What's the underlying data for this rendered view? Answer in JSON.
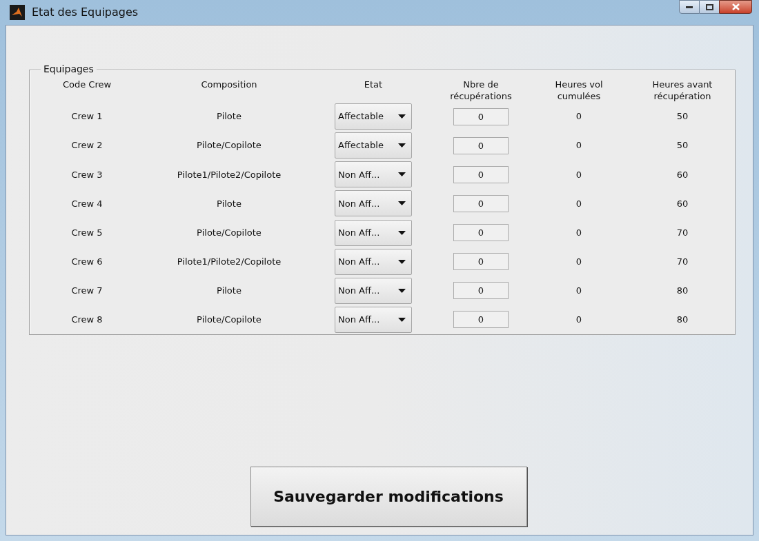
{
  "window": {
    "title": "Etat des Equipages"
  },
  "panel": {
    "title": "Equipages"
  },
  "columns": [
    "Code Crew",
    "Composition",
    "Etat",
    "Nbre de récupérations",
    "Heures vol cumulées",
    "Heures avant récupération"
  ],
  "rows": [
    {
      "code": "Crew 1",
      "composition": "Pilote",
      "etat": "Affectable",
      "recuperations": "0",
      "heures_vol": "0",
      "heures_avant": "50"
    },
    {
      "code": "Crew 2",
      "composition": "Pilote/Copilote",
      "etat": "Affectable",
      "recuperations": "0",
      "heures_vol": "0",
      "heures_avant": "50"
    },
    {
      "code": "Crew 3",
      "composition": "Pilote1/Pilote2/Copilote",
      "etat": "Non Aff...",
      "recuperations": "0",
      "heures_vol": "0",
      "heures_avant": "60"
    },
    {
      "code": "Crew 4",
      "composition": "Pilote",
      "etat": "Non Aff...",
      "recuperations": "0",
      "heures_vol": "0",
      "heures_avant": "60"
    },
    {
      "code": "Crew 5",
      "composition": "Pilote/Copilote",
      "etat": "Non Aff...",
      "recuperations": "0",
      "heures_vol": "0",
      "heures_avant": "70"
    },
    {
      "code": "Crew 6",
      "composition": "Pilote1/Pilote2/Copilote",
      "etat": "Non Aff...",
      "recuperations": "0",
      "heures_vol": "0",
      "heures_avant": "70"
    },
    {
      "code": "Crew 7",
      "composition": "Pilote",
      "etat": "Non Aff...",
      "recuperations": "0",
      "heures_vol": "0",
      "heures_avant": "80"
    },
    {
      "code": "Crew 8",
      "composition": "Pilote/Copilote",
      "etat": "Non Aff...",
      "recuperations": "0",
      "heures_vol": "0",
      "heures_avant": "80"
    }
  ],
  "save_button": "Sauvegarder modifications"
}
